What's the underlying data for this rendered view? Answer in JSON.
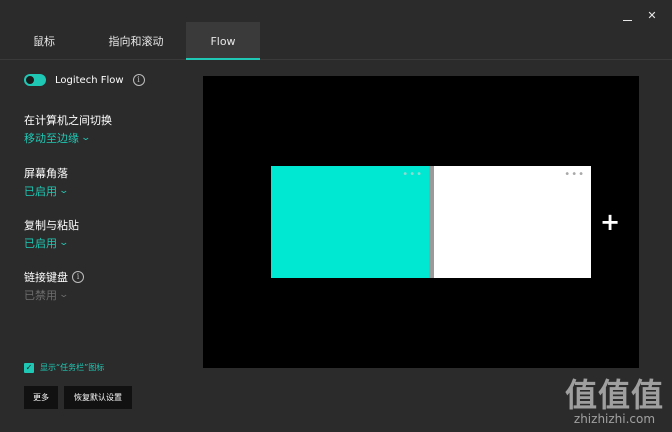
{
  "window": {
    "minimize_glyph": "",
    "close_glyph": "✕"
  },
  "tabs": [
    {
      "label": "鼠标"
    },
    {
      "label": "指向和滚动"
    },
    {
      "label": "Flow"
    }
  ],
  "flow": {
    "label": "Logitech Flow",
    "enabled": true,
    "info_glyph": "i"
  },
  "settings": [
    {
      "title": "在计算机之间切换",
      "value": "移动至边缘"
    },
    {
      "title": "屏幕角落",
      "value": "已启用"
    },
    {
      "title": "复制与粘贴",
      "value": "已启用"
    },
    {
      "title": "链接键盘",
      "value": "已禁用"
    }
  ],
  "taskbar": {
    "checked": true,
    "label": "显示“任务栏”图标"
  },
  "buttons": {
    "more": "更多",
    "reset": "恢复默认设置"
  },
  "preview": {
    "dots": "•••",
    "add_glyph": "+",
    "colors": {
      "active": "#00e8d2",
      "inactive": "#ffffff"
    }
  },
  "watermark": {
    "big": "值值值",
    "small": "zhizhizhi.com"
  },
  "colors": {
    "accent": "#1fc8b5",
    "background": "#2b2b2b",
    "preview_bg": "#000000"
  }
}
